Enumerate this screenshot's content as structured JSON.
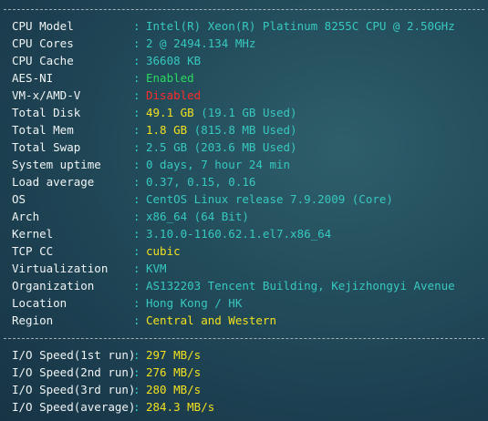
{
  "separator": "----------------------------------------------------------------------",
  "colors": {
    "background": "#234d5b",
    "label": "#f0f4f5",
    "cyan": "#37c8c0",
    "green": "#29d95e",
    "red": "#ff2b2b",
    "yellow": "#f2e01f"
  },
  "system_info": [
    {
      "label": "CPU Model",
      "value": "Intel(R) Xeon(R) Platinum 8255C CPU @ 2.50GHz",
      "color": "cyan"
    },
    {
      "label": "CPU Cores",
      "value": "2 @ 2494.134 MHz",
      "color": "cyan"
    },
    {
      "label": "CPU Cache",
      "value": "36608 KB",
      "color": "cyan"
    },
    {
      "label": "AES-NI",
      "value": "Enabled",
      "color": "green"
    },
    {
      "label": "VM-x/AMD-V",
      "value": "Disabled",
      "color": "red"
    },
    {
      "label": "Total Disk",
      "value": "49.1 GB",
      "extra": "(19.1 GB Used)",
      "color": "yellow"
    },
    {
      "label": "Total Mem",
      "value": "1.8 GB",
      "extra": "(815.8 MB Used)",
      "color": "yellow"
    },
    {
      "label": "Total Swap",
      "value": "2.5 GB (203.6 MB Used)",
      "color": "cyan"
    },
    {
      "label": "System uptime",
      "value": "0 days, 7 hour 24 min",
      "color": "cyan"
    },
    {
      "label": "Load average",
      "value": "0.37, 0.15, 0.16",
      "color": "cyan"
    },
    {
      "label": "OS",
      "value": "CentOS Linux release 7.9.2009 (Core)",
      "color": "cyan"
    },
    {
      "label": "Arch",
      "value": "x86_64 (64 Bit)",
      "color": "cyan"
    },
    {
      "label": "Kernel",
      "value": "3.10.0-1160.62.1.el7.x86_64",
      "color": "cyan"
    },
    {
      "label": "TCP CC",
      "value": "cubic",
      "color": "yellow"
    },
    {
      "label": "Virtualization",
      "value": "KVM",
      "color": "cyan"
    },
    {
      "label": "Organization",
      "value": "AS132203 Tencent Building, Kejizhongyi Avenue",
      "color": "cyan"
    },
    {
      "label": "Location",
      "value": "Hong Kong / HK",
      "color": "cyan"
    },
    {
      "label": "Region",
      "value": "Central and Western",
      "color": "yellow"
    }
  ],
  "io_speed": [
    {
      "label": "I/O Speed(1st run)",
      "value": "297 MB/s",
      "color": "yellow"
    },
    {
      "label": "I/O Speed(2nd run)",
      "value": "276 MB/s",
      "color": "yellow"
    },
    {
      "label": "I/O Speed(3rd run)",
      "value": "280 MB/s",
      "color": "yellow"
    },
    {
      "label": "I/O Speed(average)",
      "value": "284.3 MB/s",
      "color": "yellow"
    }
  ]
}
